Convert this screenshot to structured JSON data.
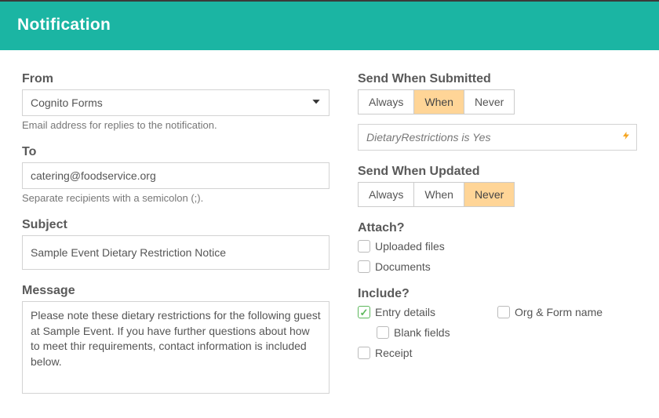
{
  "header": {
    "title": "Notification"
  },
  "from": {
    "label": "From",
    "value": "Cognito Forms",
    "helper": "Email address for replies to the notification."
  },
  "to": {
    "label": "To",
    "value": "catering@foodservice.org",
    "helper": "Separate recipients with a semicolon (;)."
  },
  "subject": {
    "label": "Subject",
    "value": "Sample Event Dietary Restriction Notice"
  },
  "message": {
    "label": "Message",
    "value": "Please note these dietary restrictions for the following guest at Sample Event. If you have further questions about how to meet thir requirements, contact information is included below."
  },
  "sendSubmitted": {
    "label": "Send When Submitted",
    "options": {
      "always": "Always",
      "when": "When",
      "never": "Never"
    },
    "condition": "DietaryRestrictions is Yes"
  },
  "sendUpdated": {
    "label": "Send When Updated",
    "options": {
      "always": "Always",
      "when": "When",
      "never": "Never"
    }
  },
  "attach": {
    "label": "Attach?",
    "uploaded": "Uploaded files",
    "documents": "Documents"
  },
  "include": {
    "label": "Include?",
    "entryDetails": "Entry details",
    "orgForm": "Org & Form name",
    "blankFields": "Blank fields",
    "receipt": "Receipt"
  }
}
